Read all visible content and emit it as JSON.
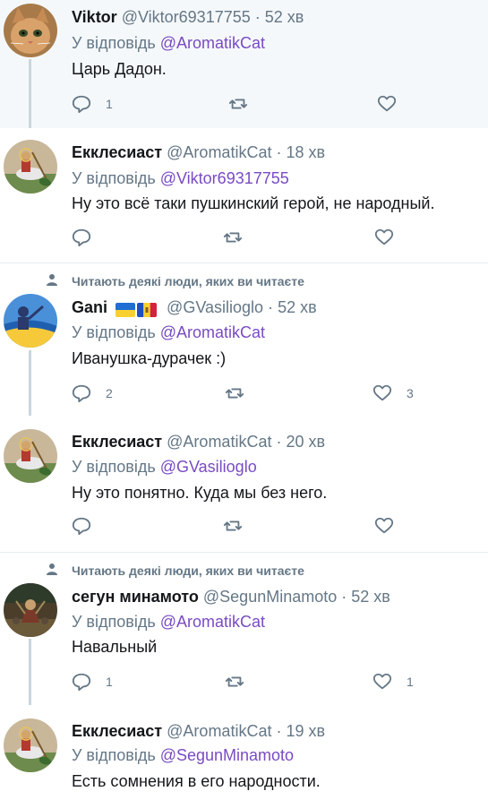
{
  "social_context": "Читають деякі люди, яких ви читаєте",
  "reply_prefix": "У відповідь",
  "tweets": [
    {
      "name": "Viktor",
      "handle": "@Viktor69317755",
      "time": "52 хв",
      "reply_to": "@AromatikCat",
      "text": "Царь Дадон.",
      "replies": "1",
      "retweets": "",
      "likes": ""
    },
    {
      "name": "Екклесиаст",
      "handle": "@AromatikCat",
      "time": "18 хв",
      "reply_to": "@Viktor69317755",
      "text": "Ну это всё таки пушкинский герой, не народный.",
      "replies": "",
      "retweets": "",
      "likes": ""
    },
    {
      "name": "Gani",
      "handle": "@GVasilioglo",
      "time": "52 хв",
      "reply_to": "@AromatikCat",
      "text": "Иванушка-дурачек :)",
      "replies": "2",
      "retweets": "",
      "likes": "3"
    },
    {
      "name": "Екклесиаст",
      "handle": "@AromatikCat",
      "time": "20 хв",
      "reply_to": "@GVasilioglo",
      "text": "Ну это понятно. Куда мы без него.",
      "replies": "",
      "retweets": "",
      "likes": ""
    },
    {
      "name": "сегун минамото",
      "handle": "@SegunMinamoto",
      "time": "52 хв",
      "reply_to": "@AromatikCat",
      "text": "Навальный",
      "replies": "1",
      "retweets": "",
      "likes": "1"
    },
    {
      "name": "Екклесиаст",
      "handle": "@AromatikCat",
      "time": "19 хв",
      "reply_to": "@SegunMinamoto",
      "text": "Есть сомнения в его народности.",
      "replies": "",
      "retweets": "",
      "likes": ""
    }
  ],
  "dot": "·",
  "colors": {
    "accent": "#794bc4",
    "secondary": "#657786",
    "shaded_bg": "#f5f8fa"
  }
}
